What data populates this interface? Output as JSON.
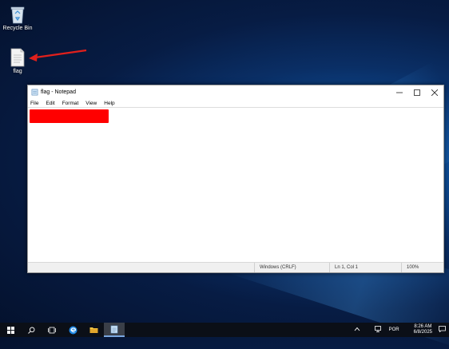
{
  "desktop": {
    "icons": [
      {
        "label": "Recycle Bin",
        "icon": "recycle-bin-icon"
      },
      {
        "label": "flag",
        "icon": "text-file-icon"
      }
    ],
    "annotation_color": "#e0201c"
  },
  "notepad": {
    "title": "flag - Notepad",
    "menu": [
      "File",
      "Edit",
      "Format",
      "View",
      "Help"
    ],
    "content_redacted": true,
    "redaction_color": "#ff0000",
    "status": {
      "line_ending": "Windows (CRLF)",
      "position": "Ln 1, Col 1",
      "zoom": "100%"
    }
  },
  "taskbar": {
    "items": [
      "start-icon",
      "search-icon",
      "task-view-icon",
      "edge-icon",
      "file-explorer-icon",
      "notepad-icon"
    ],
    "active": "notepad-icon",
    "tray": {
      "language": "POR",
      "time": "8:26 AM",
      "date": "6/8/2025"
    }
  }
}
